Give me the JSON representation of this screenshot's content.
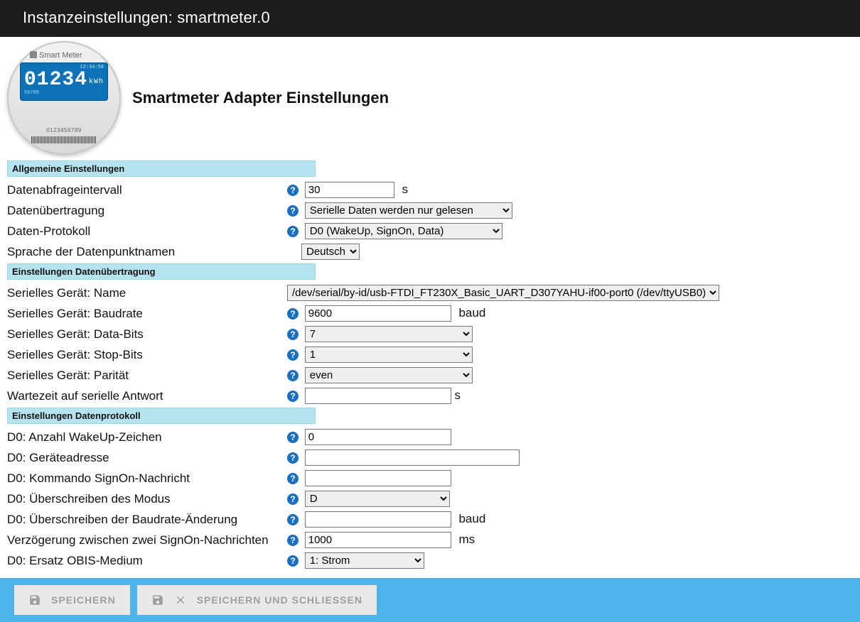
{
  "header": {
    "title": "Instanzeinstellungen: smartmeter.0"
  },
  "meter_icon": {
    "brand": "Smart Meter",
    "time": "12:34:56",
    "reading": "01234",
    "unit": "kWh",
    "sub": "56789",
    "serial": "0123456789"
  },
  "page_title": "Smartmeter Adapter Einstellungen",
  "sections": {
    "general_hdr": "Allgemeine Einstellungen",
    "transport_hdr": "Einstellungen Datenübertragung",
    "protocol_hdr": "Einstellungen Datenprotokoll"
  },
  "general": {
    "poll_interval": {
      "label": "Datenabfrageintervall",
      "value": "30",
      "unit": "s"
    },
    "transport": {
      "label": "Datenübertragung",
      "value": "Serielle Daten werden nur gelesen"
    },
    "protocol": {
      "label": "Daten-Protokoll",
      "value": "D0 (WakeUp, SignOn, Data)"
    },
    "dp_language": {
      "label": "Sprache der Datenpunktnamen",
      "value": "Deutsch"
    }
  },
  "serial": {
    "device_name": {
      "label": "Serielles Gerät: Name",
      "value": "/dev/serial/by-id/usb-FTDI_FT230X_Basic_UART_D307YAHU-if00-port0 (/dev/ttyUSB0)"
    },
    "baudrate": {
      "label": "Serielles Gerät: Baudrate",
      "value": "9600",
      "unit": "baud"
    },
    "databits": {
      "label": "Serielles Gerät: Data-Bits",
      "value": "7"
    },
    "stopbits": {
      "label": "Serielles Gerät: Stop-Bits",
      "value": "1"
    },
    "parity": {
      "label": "Serielles Gerät: Parität",
      "value": "even"
    },
    "resp_timeout": {
      "label": "Wartezeit auf serielle Antwort",
      "value": "",
      "unit": "s"
    }
  },
  "d0": {
    "wakeup_chars": {
      "label": "D0: Anzahl WakeUp-Zeichen",
      "value": "0"
    },
    "device_addr": {
      "label": "D0: Geräteadresse",
      "value": ""
    },
    "signon_cmd": {
      "label": "D0: Kommando SignOn-Nachricht",
      "value": ""
    },
    "mode_override": {
      "label": "D0: Überschreiben des Modus",
      "value": "D"
    },
    "baud_override": {
      "label": "D0: Überschreiben der Baudrate-Änderung",
      "value": "",
      "unit": "baud"
    },
    "signon_delay": {
      "label": "Verzögerung zwischen zwei SignOn-Nachrichten",
      "value": "1000",
      "unit": "ms"
    },
    "obis_medium": {
      "label": "D0: Ersatz OBIS-Medium",
      "value": "1: Strom"
    }
  },
  "footer": {
    "save": "Speichern",
    "save_close": "Speichern und Schliessen"
  }
}
